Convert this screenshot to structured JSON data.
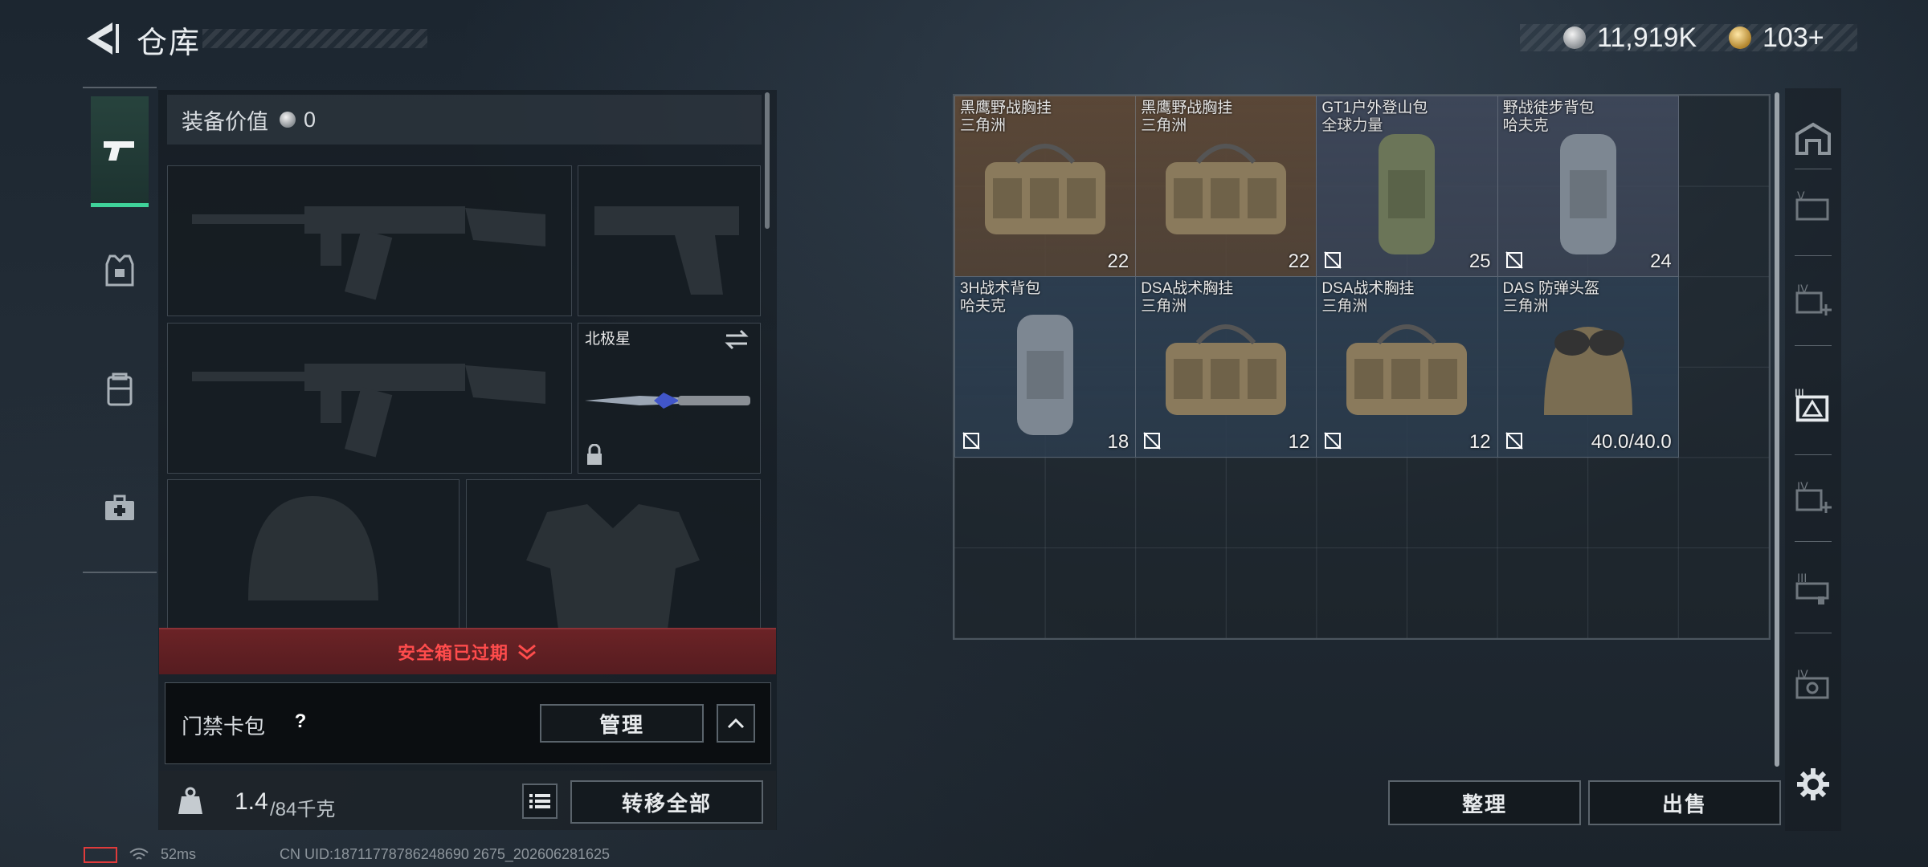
{
  "header": {
    "title": "仓库",
    "silver_amount": "11,919K",
    "gold_amount": "103+"
  },
  "loadout": {
    "equip_value_label": "装备价值",
    "equip_value": "0",
    "melee_name": "北极星",
    "safebox_text": "安全箱已过期",
    "keycard_label": "门禁卡包",
    "keycard_help": "?",
    "manage_label": "管理",
    "weight_current": "1.4",
    "weight_max": "/84千克",
    "transfer_all_label": "转移全部"
  },
  "storage": {
    "items": [
      {
        "name": "黑鹰野战胸挂",
        "sub": "三角洲",
        "count": "22",
        "color": "#5a4737",
        "type": "rig"
      },
      {
        "name": "黑鹰野战胸挂",
        "sub": "三角洲",
        "count": "22",
        "color": "#5a4737",
        "type": "rig"
      },
      {
        "name": "GT1户外登山包",
        "sub": "全球力量",
        "count": "25",
        "color": "#3d4658",
        "type": "backpack-green"
      },
      {
        "name": "野战徒步背包",
        "sub": "哈夫克",
        "count": "24",
        "color": "#3d4658",
        "type": "backpack-grey"
      },
      {
        "name": "3H战术背包",
        "sub": "哈夫克",
        "count": "18",
        "color": "#2c3d4f",
        "type": "backpack-grey"
      },
      {
        "name": "DSA战术胸挂",
        "sub": "三角洲",
        "count": "12",
        "color": "#2c3d4f",
        "type": "rig"
      },
      {
        "name": "DSA战术胸挂",
        "sub": "三角洲",
        "count": "12",
        "color": "#2c3d4f",
        "type": "rig"
      },
      {
        "name": "DAS 防弹头盔",
        "sub": "三角洲",
        "count": "40.0/40.0",
        "color": "#2c3d4f",
        "type": "helmet"
      }
    ],
    "sort_label": "整理",
    "sell_label": "出售"
  },
  "status": {
    "ping": "52ms",
    "uid": "CN UID:18711778786248690 2675_202606281625"
  }
}
